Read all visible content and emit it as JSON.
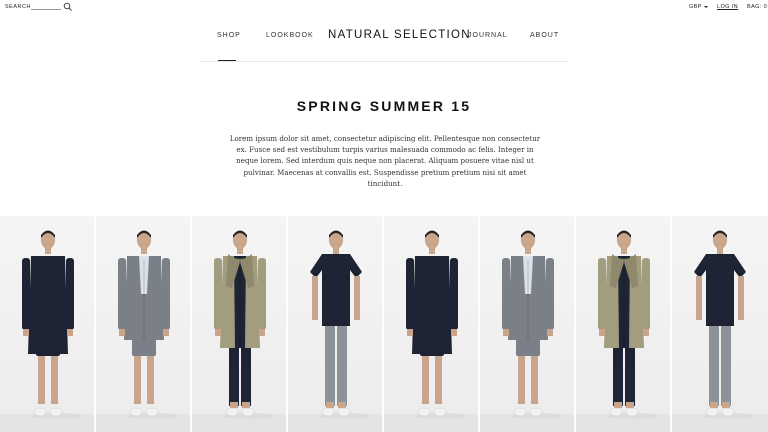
{
  "topbar": {
    "search_label": "SEARCH",
    "currency": "GBP",
    "login": "LOG IN",
    "bag": "BAG: 0"
  },
  "nav": {
    "shop": "SHOP",
    "lookbook": "LOOKBOOK",
    "brand": "NATURAL SELECTION",
    "journal": "JOURNAL",
    "about": "ABOUT",
    "active": "shop"
  },
  "page": {
    "title": "SPRING SUMMER 15",
    "intro": "Lorem ipsum dolor sit amet, consectetur adipiscing elit. Pellentesque non consectetur ex. Fusce sed est vestibulum turpis varius malesuada commodo ac felis. Integer in neque lorem. Sed interdum quis neque non placerat. Aliquam posuere vitae nisl ut pulvinar. Maecenas at convallis est. Suspendisse pretium pretium nisi sit amet tincidunt."
  },
  "colors": {
    "navy": "#1e2433",
    "grey_suit": "#7b7f87",
    "khaki": "#a29d7f",
    "skin": "#c9a58b",
    "shirt_light": "#d9e0ea",
    "trouser_grey": "#8d9199",
    "sneaker": "#f2f2f2"
  },
  "lookbook": {
    "looks": [
      {
        "outfit": "navy-coat-shorts"
      },
      {
        "outfit": "grey-blazer-shorts"
      },
      {
        "outfit": "khaki-parka-navy-trousers"
      },
      {
        "outfit": "navy-tee-grey-trousers"
      },
      {
        "outfit": "navy-coat-shorts"
      },
      {
        "outfit": "grey-blazer-shorts"
      },
      {
        "outfit": "khaki-parka-navy-trousers"
      },
      {
        "outfit": "navy-tee-grey-trousers"
      }
    ]
  }
}
